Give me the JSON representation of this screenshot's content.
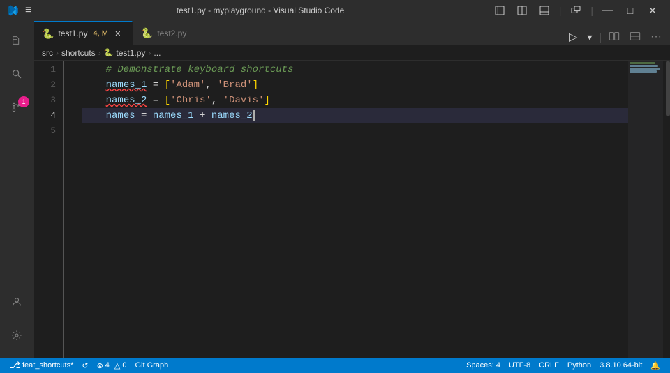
{
  "titleBar": {
    "title": "test1.py - myplayground - Visual Studio Code",
    "menuIcon": "≡",
    "windowControls": [
      "□",
      "❐",
      "✕"
    ]
  },
  "tabs": [
    {
      "id": "tab1",
      "label": "test1.py",
      "badge": "4, M",
      "active": true,
      "modified": true
    },
    {
      "id": "tab2",
      "label": "test2.py",
      "active": false,
      "modified": false
    }
  ],
  "breadcrumb": {
    "parts": [
      "src",
      "shortcuts",
      "test1.py",
      "..."
    ]
  },
  "code": {
    "lines": [
      {
        "num": 1,
        "content": "    # Demonstrate keyboard shortcuts"
      },
      {
        "num": 2,
        "content": "    names_1 = ['Adam', 'Brad']"
      },
      {
        "num": 3,
        "content": "    names_2 = ['Chris', 'Davis']"
      },
      {
        "num": 4,
        "content": "    names = names_1 + names_2"
      },
      {
        "num": 5,
        "content": ""
      }
    ]
  },
  "statusBar": {
    "branch": "feat_shortcuts*",
    "syncIcon": "↺",
    "errors": "⊗ 4",
    "warnings": "△ 0",
    "gitGraph": "Git Graph",
    "spaces": "Spaces: 4",
    "encoding": "UTF-8",
    "lineEnding": "CRLF",
    "language": "Python",
    "version": "3.8.10 64-bit",
    "notifications": "🔔"
  },
  "activityBar": {
    "items": [
      {
        "id": "explorer",
        "icon": "files",
        "active": false
      },
      {
        "id": "search",
        "icon": "search",
        "active": false
      },
      {
        "id": "source-control",
        "icon": "source-control",
        "active": false,
        "badge": "1"
      },
      {
        "id": "run",
        "icon": "run",
        "active": false
      },
      {
        "id": "extensions",
        "icon": "extensions",
        "active": false
      }
    ]
  }
}
